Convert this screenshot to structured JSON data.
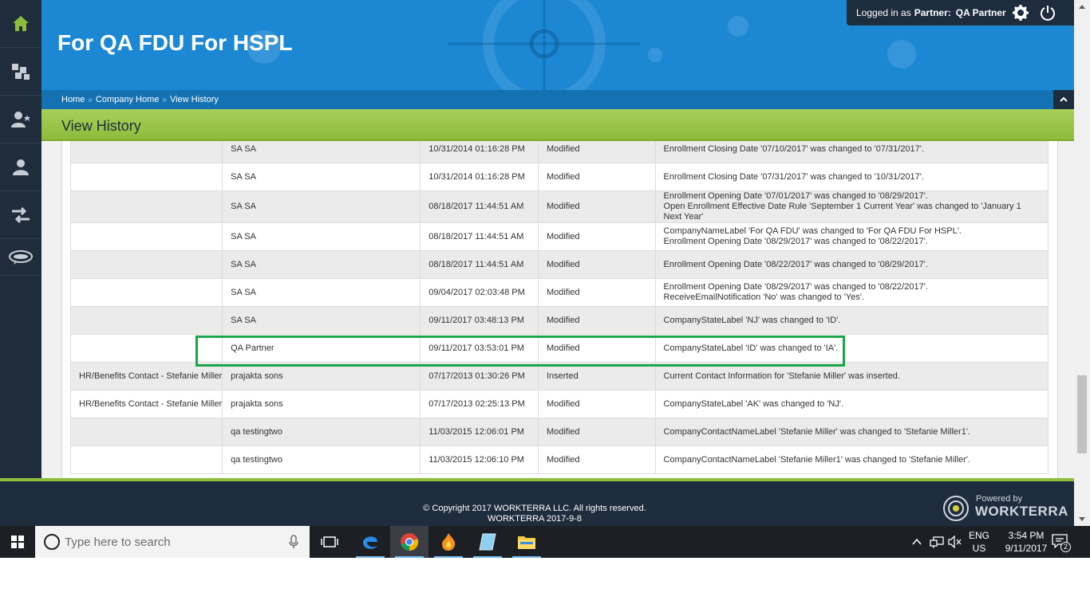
{
  "header": {
    "site_title": "For QA FDU For HSPL",
    "logged_in_label": "Logged in as",
    "role_label": "Partner:",
    "user_name": "QA Partner"
  },
  "breadcrumb": [
    {
      "label": "Home"
    },
    {
      "label": "Company Home"
    },
    {
      "label": "View History"
    }
  ],
  "breadcrumb_separator": "»",
  "page": {
    "title": "View History"
  },
  "history_rows": [
    {
      "item": "",
      "user": "SA SA",
      "date": "10/31/2014 01:16:28 PM",
      "action": "Modified",
      "lines": [
        "Enrollment Closing Date '07/10/2017' was changed to '07/31/2017'."
      ]
    },
    {
      "item": "",
      "user": "SA SA",
      "date": "10/31/2014 01:16:28 PM",
      "action": "Modified",
      "lines": [
        "Enrollment Closing Date '07/31/2017' was changed to '10/31/2017'."
      ]
    },
    {
      "item": "",
      "user": "SA SA",
      "date": "08/18/2017 11:44:51 AM",
      "action": "Modified",
      "lines": [
        "Enrollment Opening Date '07/01/2017' was changed to '08/29/2017'.",
        "Open Enrollment Effective Date Rule 'September 1 Current Year' was changed to 'January 1 Next Year'"
      ]
    },
    {
      "item": "",
      "user": "SA SA",
      "date": "08/18/2017 11:44:51 AM",
      "action": "Modified",
      "lines": [
        "CompanyNameLabel 'For QA FDU' was changed to 'For QA FDU For HSPL'.",
        "Enrollment Opening Date '08/29/2017' was changed to '08/22/2017'."
      ]
    },
    {
      "item": "",
      "user": "SA SA",
      "date": "08/18/2017 11:44:51 AM",
      "action": "Modified",
      "lines": [
        "Enrollment Opening Date '08/22/2017' was changed to '08/29/2017'."
      ]
    },
    {
      "item": "",
      "user": "SA SA",
      "date": "09/04/2017 02:03:48 PM",
      "action": "Modified",
      "lines": [
        "Enrollment Opening Date '08/29/2017' was changed to '08/22/2017'.",
        "ReceiveEmailNotification 'No' was changed to 'Yes'."
      ]
    },
    {
      "item": "",
      "user": "SA SA",
      "date": "09/11/2017 03:48:13 PM",
      "action": "Modified",
      "lines": [
        "CompanyStateLabel 'NJ' was changed to 'ID'."
      ]
    },
    {
      "item": "",
      "user": "QA Partner",
      "date": "09/11/2017 03:53:01 PM",
      "action": "Modified",
      "lines": [
        "CompanyStateLabel 'ID' was changed to 'IA'."
      ]
    },
    {
      "item": "HR/Benefits Contact - Stefanie Miller",
      "user": "prajakta sons",
      "date": "07/17/2013 01:30:26 PM",
      "action": "Inserted",
      "lines": [
        "Current Contact Information for 'Stefanie Miller' was inserted."
      ]
    },
    {
      "item": "HR/Benefits Contact - Stefanie Miller",
      "user": "prajakta sons",
      "date": "07/17/2013 02:25:13 PM",
      "action": "Modified",
      "lines": [
        "CompanyStateLabel 'AK' was changed to 'NJ'."
      ]
    },
    {
      "item": "",
      "user": "qa testingtwo",
      "date": "11/03/2015 12:06:01 PM",
      "action": "Modified",
      "lines": [
        "CompanyContactNameLabel 'Stefanie Miller' was changed to 'Stefanie Miller1'."
      ]
    },
    {
      "item": "",
      "user": "qa testingtwo",
      "date": "11/03/2015 12:06:10 PM",
      "action": "Modified",
      "lines": [
        "CompanyContactNameLabel 'Stefanie Miller1' was changed to 'Stefanie Miller'."
      ]
    }
  ],
  "footer": {
    "copyright": "© Copyright 2017 WORKTERRA LLC. All rights reserved.",
    "version": "WORKTERRA 2017-9-8",
    "powered_by": "Powered by",
    "brand": "WORKTERRA"
  },
  "taskbar": {
    "search_placeholder": "Type here to search",
    "lang_line1": "ENG",
    "lang_line2": "US",
    "time": "3:54 PM",
    "date": "9/11/2017",
    "notification_count": "2"
  },
  "colors": {
    "header_blue": "#1c88d4",
    "sidebar_dark": "#1f2c3b",
    "title_green": "#8dbd3c",
    "highlight_green": "#1aa64a"
  }
}
